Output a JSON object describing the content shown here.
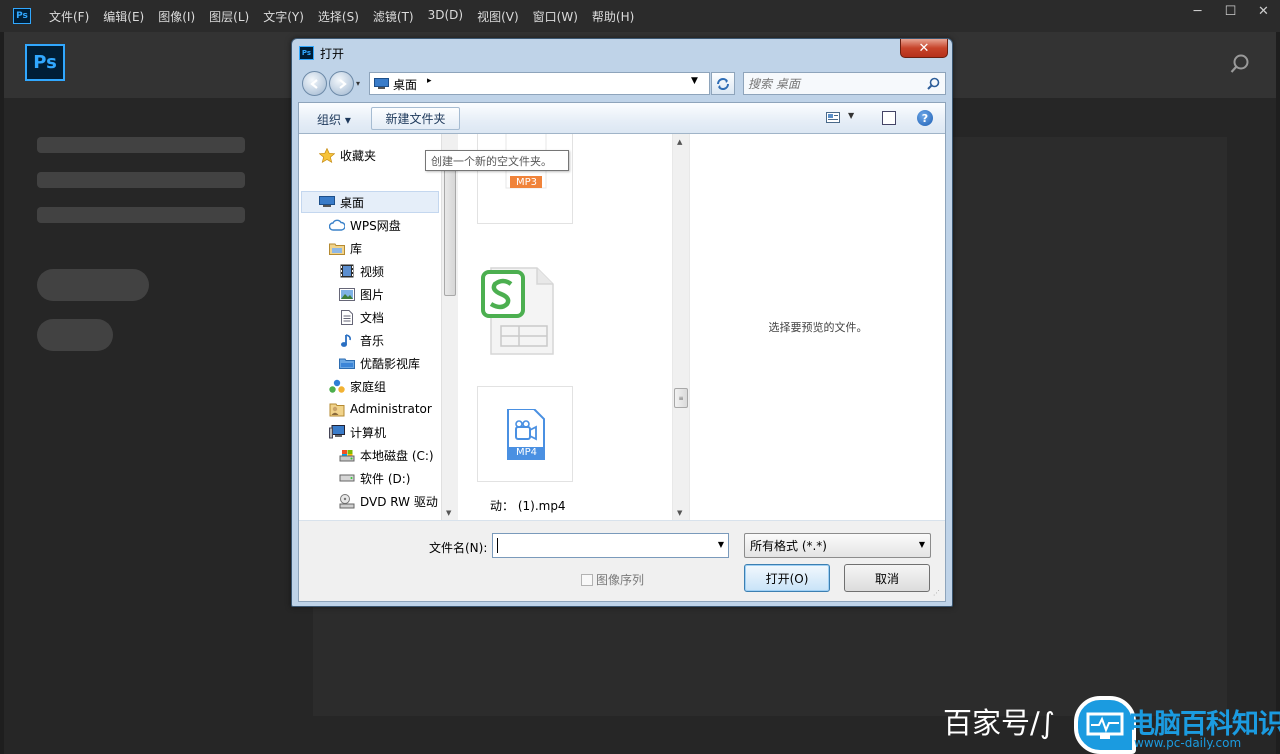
{
  "ps": {
    "mini_logo": "Ps",
    "logo": "Ps",
    "menu": [
      "文件(F)",
      "编辑(E)",
      "图像(I)",
      "图层(L)",
      "文字(Y)",
      "选择(S)",
      "滤镜(T)",
      "3D(D)",
      "视图(V)",
      "窗口(W)",
      "帮助(H)"
    ],
    "win_minimize": "─",
    "win_restore": "☐",
    "win_close": "✕",
    "accent": "#31a8ff"
  },
  "dialog": {
    "icon": "Ps",
    "title": "打开",
    "close": "✕",
    "address": {
      "location": "桌面",
      "arrow": "▸",
      "dropdown": "▼"
    },
    "search": {
      "placeholder": "搜索 桌面"
    },
    "commandbar": {
      "organize": "组织 ▾",
      "new_folder": "新建文件夹",
      "view_dropdown": "▼",
      "help": "?"
    },
    "tooltip": "创建一个新的空文件夹。",
    "nav": [
      {
        "label": "收藏夹",
        "icon": "star-icon"
      },
      {
        "label": "桌面",
        "icon": "desktop-icon",
        "selected": true
      },
      {
        "label": "WPS网盘",
        "icon": "cloud-icon"
      },
      {
        "label": "库",
        "icon": "library-icon"
      },
      {
        "label": "视频",
        "icon": "video-icon"
      },
      {
        "label": "图片",
        "icon": "picture-icon"
      },
      {
        "label": "文档",
        "icon": "document-icon"
      },
      {
        "label": "音乐",
        "icon": "music-icon"
      },
      {
        "label": "优酷影视库",
        "icon": "youku-icon"
      },
      {
        "label": "家庭组",
        "icon": "homegroup-icon"
      },
      {
        "label": "Administrator",
        "icon": "user-folder-icon"
      },
      {
        "label": "计算机",
        "icon": "computer-icon"
      },
      {
        "label": "本地磁盘 (C:)",
        "icon": "drive-c-icon"
      },
      {
        "label": "软件 (D:)",
        "icon": "drive-d-icon"
      },
      {
        "label": "DVD RW 驱动",
        "icon": "dvd-drive-icon"
      }
    ],
    "files": {
      "mp3_badge": "MP3",
      "mp4_badge": "MP4",
      "mp4_label": "动： (1).mp4"
    },
    "preview_text": "选择要预览的文件。",
    "filename_label": "文件名(N):",
    "filename_value": "",
    "format_selected": "所有格式 (*.*)",
    "image_sequence_label": "图像序列",
    "open_button": "打开(O)",
    "cancel_button": "取消"
  },
  "watermark": {
    "left_text": "百家号/∫",
    "title": "电脑百科知识",
    "url": "www.pc-daily.com"
  }
}
